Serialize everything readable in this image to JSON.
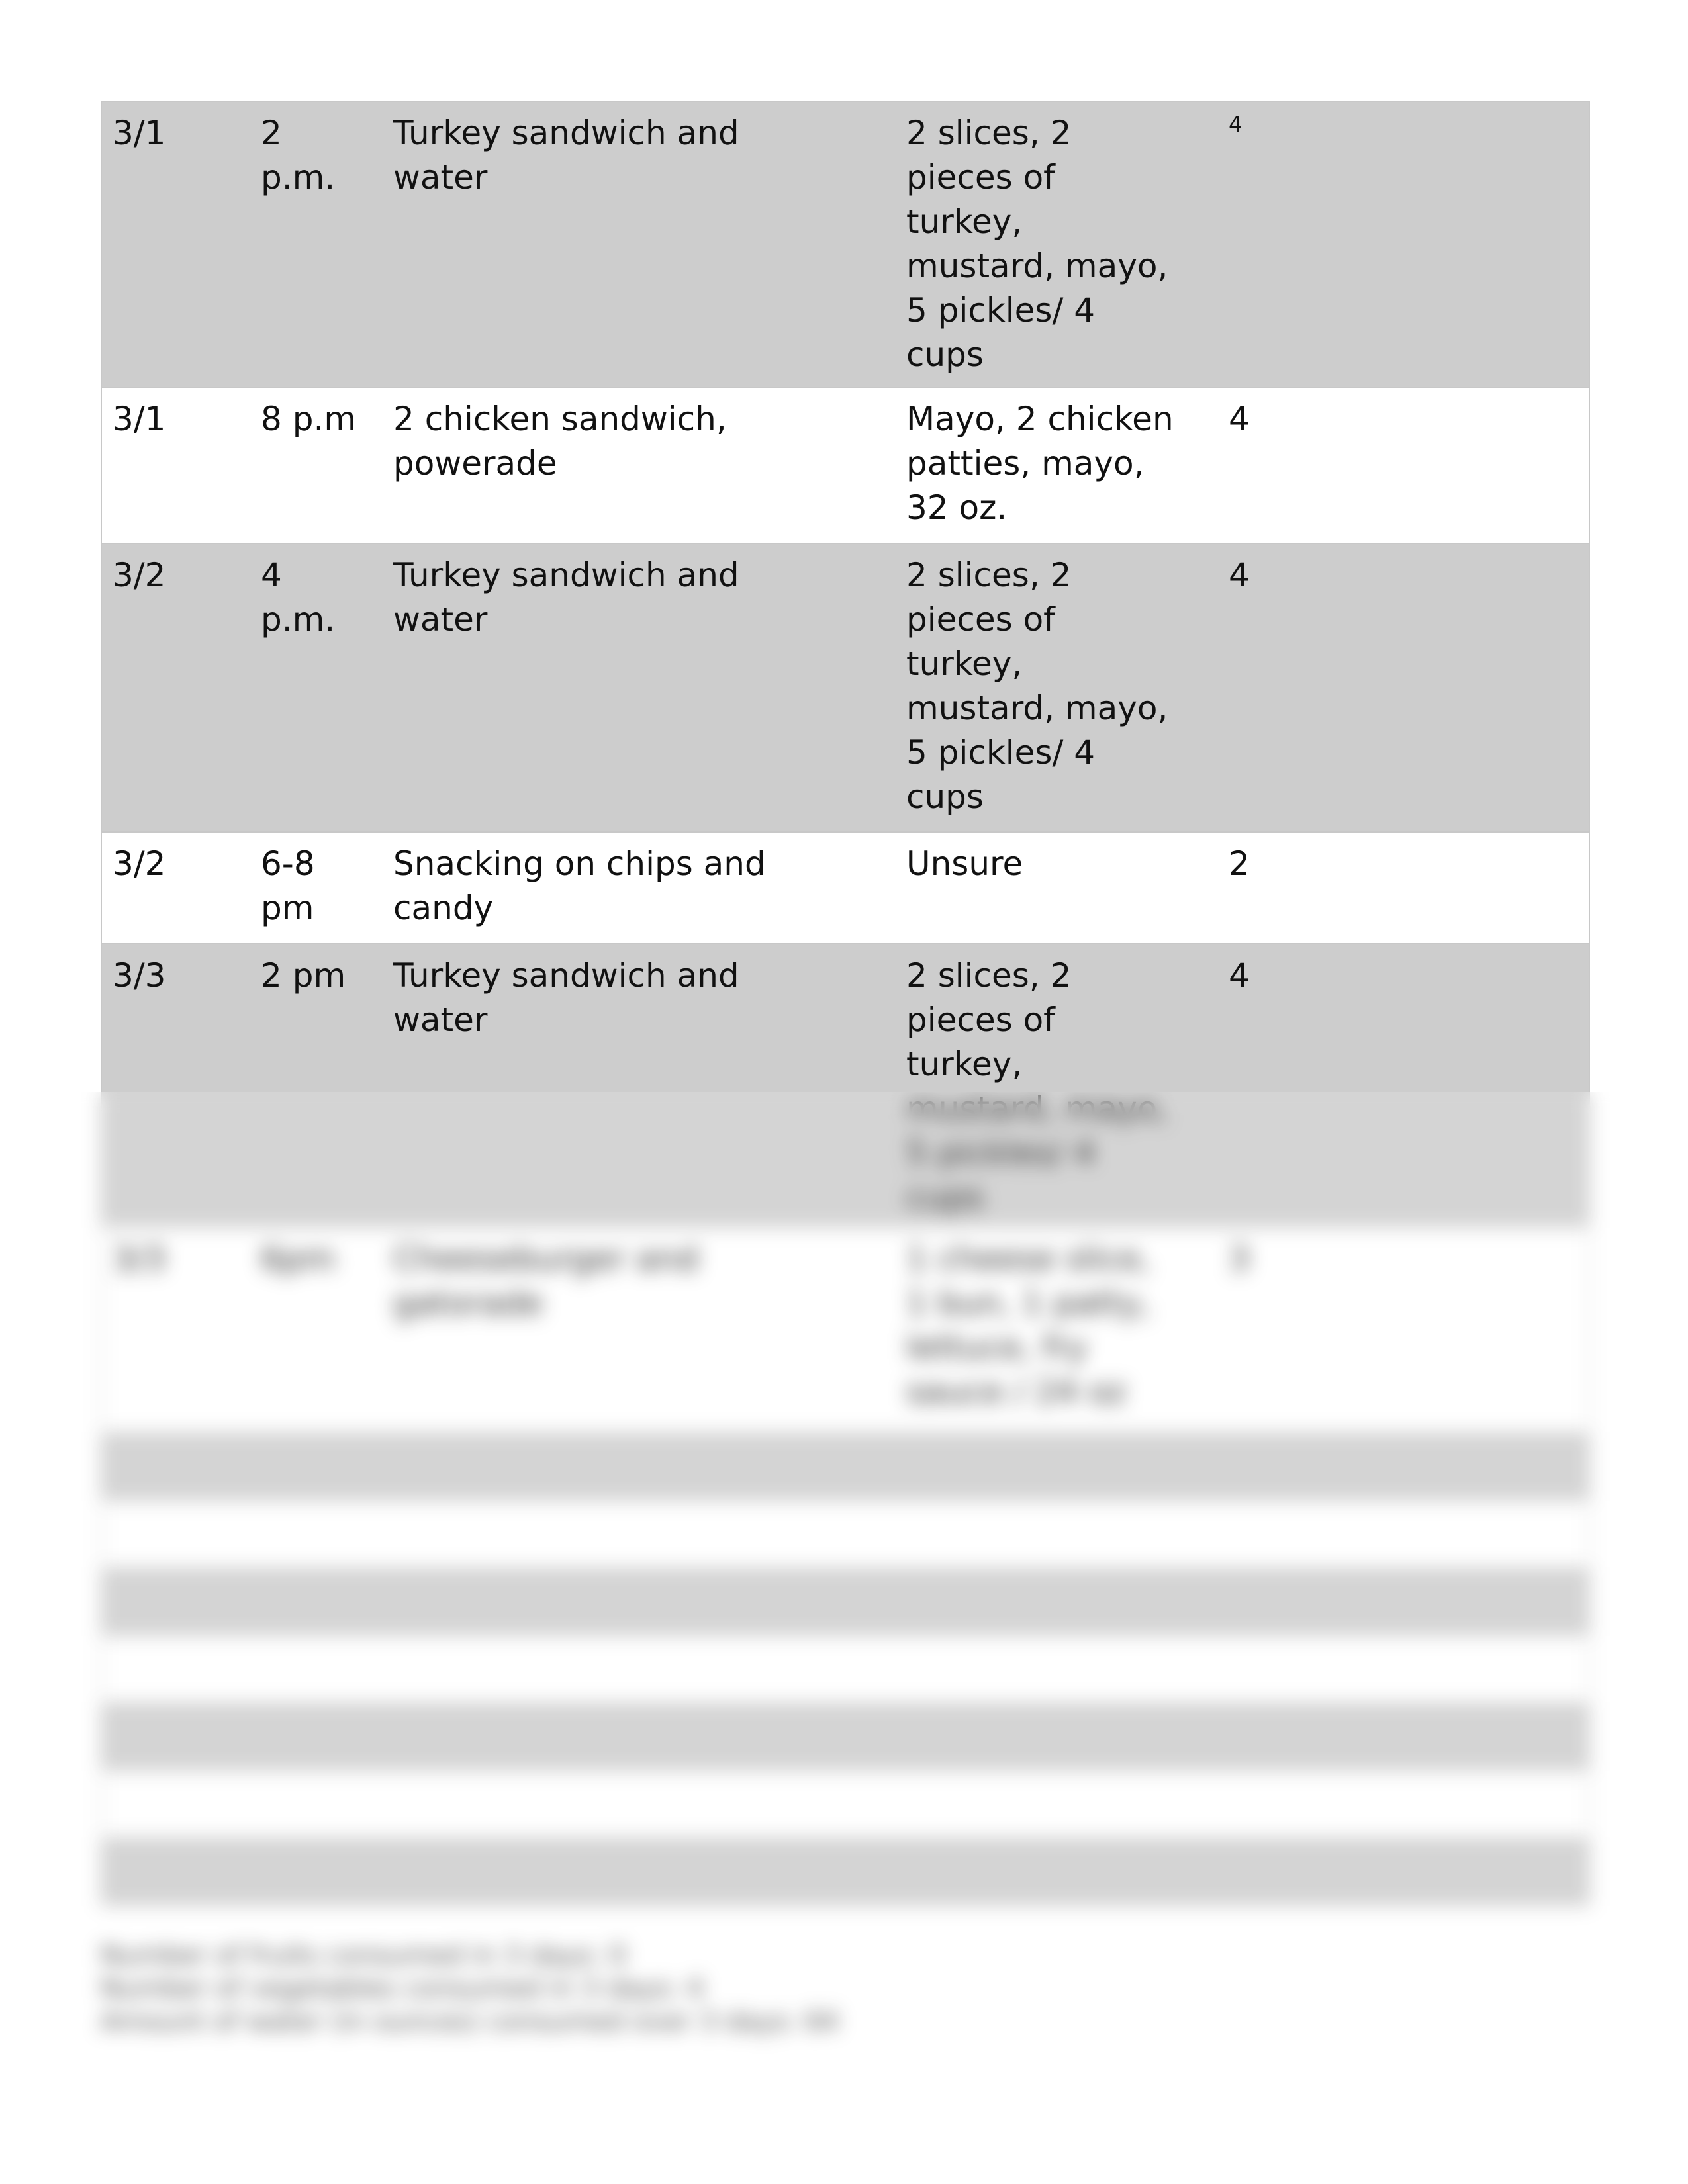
{
  "rows": [
    {
      "date": "3/1",
      "time": "2\np.m.",
      "food": "Turkey sandwich and\nwater",
      "details": "2 slices, 2\npieces of\nturkey,\nmustard, mayo,\n5 pickles/ 4\ncups",
      "portions": "4",
      "shade": "gray"
    },
    {
      "date": "3/1",
      "time": "8 p.m",
      "food": "2 chicken sandwich,\npowerade",
      "details": "Mayo, 2 chicken\npatties, mayo,\n32 oz.",
      "portions": "4",
      "shade": "white"
    },
    {
      "date": "3/2",
      "time": "4\np.m.",
      "food": "Turkey sandwich and\nwater",
      "details": "2 slices, 2\npieces of\nturkey,\nmustard, mayo,\n5 pickles/ 4\ncups",
      "portions": "4",
      "shade": "gray"
    },
    {
      "date": "3/2",
      "time": "6-8\npm",
      "food": "Snacking on chips and\ncandy",
      "details": "Unsure",
      "portions": "2",
      "shade": "white"
    },
    {
      "date": "3/3",
      "time": "2 pm",
      "food": "Turkey sandwich and\nwater",
      "details": "2 slices, 2\npieces of\nturkey,\nmustard, mayo,\n5 pickles/ 4\ncups",
      "portions": "4",
      "shade": "gray"
    },
    {
      "date": "3/3",
      "time": "6pm",
      "food": "Cheeseburger and\ngatorade",
      "details": "1 cheese slice,\n1 bun, 1 patty,\nlettuce, fry\nsauce / 24 oz",
      "portions": "3",
      "shade": "white"
    },
    {
      "date": "",
      "time": "",
      "food": "",
      "details": "",
      "portions": "",
      "shade": "gray"
    },
    {
      "date": "",
      "time": "",
      "food": "",
      "details": "",
      "portions": "",
      "shade": "white"
    },
    {
      "date": "",
      "time": "",
      "food": "",
      "details": "",
      "portions": "",
      "shade": "gray"
    },
    {
      "date": "",
      "time": "",
      "food": "",
      "details": "",
      "portions": "",
      "shade": "white"
    },
    {
      "date": "",
      "time": "",
      "food": "",
      "details": "",
      "portions": "",
      "shade": "gray"
    },
    {
      "date": "",
      "time": "",
      "food": "",
      "details": "",
      "portions": "",
      "shade": "white"
    },
    {
      "date": "",
      "time": "",
      "food": "",
      "details": "",
      "portions": "",
      "shade": "gray"
    }
  ],
  "footer": {
    "fruits": "Number of fruits consumed in 3 days: 0",
    "vegetables": "Number of vegetables consumed in 3 days: 4",
    "water": "Amount of water (in ounces) consumed over 3 days: 64"
  },
  "colors": {
    "row_gray": "#cdcdcd",
    "row_white": "#ffffff",
    "border": "#c8c8c8"
  }
}
